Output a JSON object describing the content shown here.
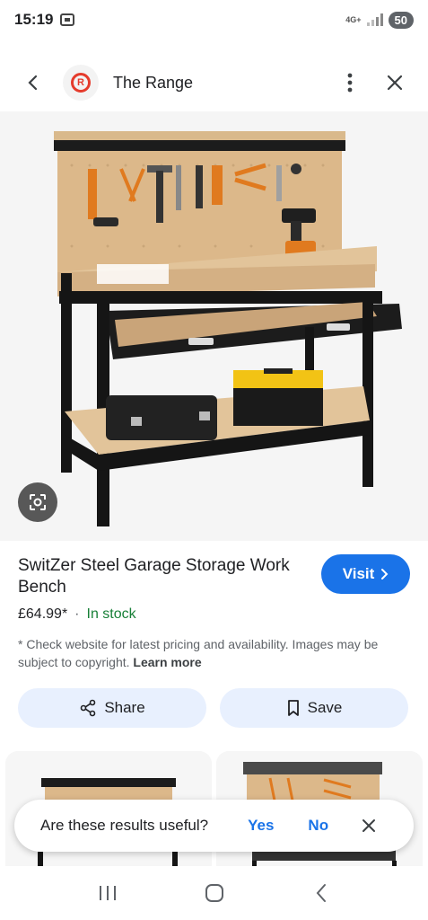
{
  "status": {
    "time": "15:19",
    "network": "4G+",
    "battery": "50"
  },
  "header": {
    "site_name": "The Range"
  },
  "product": {
    "title": "SwitZer Steel Garage Storage Work Bench",
    "price": "£64.99*",
    "separator": "·",
    "stock": "In stock",
    "disclaimer": "* Check website for latest pricing and availability. Images may be subject to copyright.",
    "learn_more": "Learn more",
    "visit_label": "Visit"
  },
  "actions": {
    "share_label": "Share",
    "save_label": "Save"
  },
  "feedback": {
    "question": "Are these results useful?",
    "yes": "Yes",
    "no": "No"
  },
  "icons": {
    "back": "chevron-left-icon",
    "more": "more-vert-icon",
    "close": "close-icon",
    "lens": "google-lens-icon",
    "share": "share-icon",
    "save": "bookmark-icon",
    "visit": "chevron-right-icon"
  },
  "colors": {
    "accent": "#1a73e8",
    "stock": "#188038",
    "brand": "#e53b2c",
    "action_bg": "#e8f0fe"
  }
}
